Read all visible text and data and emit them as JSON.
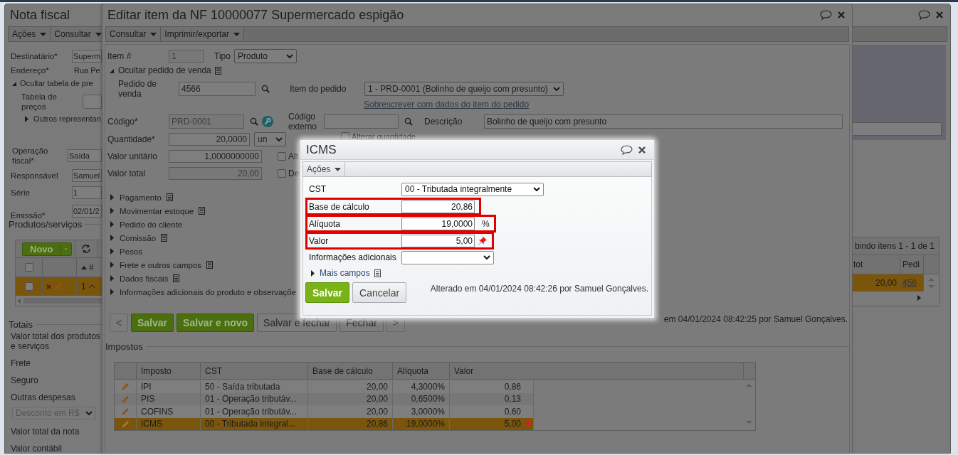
{
  "main_window": {
    "title": "Nota fiscal",
    "menu": [
      {
        "label": "Ações"
      },
      {
        "label": "Consultar"
      }
    ],
    "recipient": {
      "label": "Destinatário*",
      "value": "Superm"
    },
    "address": {
      "label": "Endereço*",
      "value": "Rua Pe"
    },
    "price_toggle": {
      "label": "Ocultar tabela de pre",
      "expanded": true
    },
    "price_table": {
      "label": "Tabela de preços"
    },
    "reps_toggle": {
      "label": "Outros representan",
      "expanded": false
    },
    "fields": [
      {
        "label": "Operação fiscal*",
        "value": "Saída"
      },
      {
        "label": "Responsável",
        "value": "Samuel"
      },
      {
        "label": "Série",
        "value": "1"
      },
      {
        "label": "Emissão*",
        "value": "02/01/2"
      }
    ],
    "products": {
      "title": "Produtos/serviços",
      "new_button": "Novo",
      "all_checked": false,
      "sort_column": "#",
      "pager": "bindo itens 1 - 1 de 1",
      "columns": [
        "tot",
        "Pedi"
      ],
      "rows": [
        {
          "number": "1",
          "checked": false,
          "selected": true,
          "total": "20,00",
          "order": "456"
        }
      ]
    },
    "totals": {
      "title": "Totais",
      "labels": [
        "Valor total dos produtos e serviços",
        "Frete",
        "Seguro",
        "Outras despesas"
      ],
      "discount": {
        "value": "Desconto em R$",
        "disabled": true
      },
      "labels_after": [
        "Valor total da nota",
        "Valor contábil"
      ]
    }
  },
  "editor": {
    "title": "Editar item da NF 10000077 Supermercado espigão",
    "menu": [
      {
        "label": "Consultar"
      },
      {
        "label": "Imprimir/exportar"
      }
    ],
    "item_number": {
      "label": "Item #",
      "value": "1",
      "disabled": true
    },
    "type": {
      "label": "Tipo",
      "value": "Produto"
    },
    "order_toggle": {
      "label": "Ocultar pedido de venda",
      "expanded": true
    },
    "sales_order": {
      "label": "Pedido de venda",
      "value": "4566",
      "disabled": false
    },
    "order_item": {
      "label": "Item do pedido",
      "value": "1 - PRD-0001 (Bolinho de queijo com presunto)"
    },
    "overwrite_link": "Sobrescrever com dados do item do pedido",
    "code": {
      "label": "Código*",
      "value": "PRD-0001",
      "disabled": true
    },
    "external_code": {
      "label": "Código externo"
    },
    "description": {
      "label": "Descrição",
      "value": "Bolinho de queijo com presunto",
      "disabled": false
    },
    "quantity": {
      "label": "Quantidade*",
      "value": "20,0000",
      "unit": "un",
      "disabled": false
    },
    "change_quantity": {
      "label": "Alterar quantidade",
      "checked": false
    },
    "unit_price": {
      "label": "Valor unitário",
      "value": "1,0000000000",
      "disabled": false
    },
    "unit_price_check": {
      "label": "Alt",
      "checked": false
    },
    "total": {
      "label": "Valor total",
      "value": "20,00",
      "disabled": true
    },
    "total_check": {
      "label": "De",
      "checked": false
    },
    "sections": [
      {
        "label": "Pagamento",
        "expanded": false,
        "note": true
      },
      {
        "label": "Movimentar estoque",
        "expanded": false,
        "note": true
      },
      {
        "label": "Pedido do cliente",
        "expanded": false,
        "note": false
      },
      {
        "label": "Comissão",
        "expanded": false,
        "note": true
      },
      {
        "label": "Pesos",
        "expanded": false,
        "note": false
      },
      {
        "label": "Frete e outros campos",
        "expanded": false,
        "note": true
      },
      {
        "label": "Dados fiscais",
        "expanded": false,
        "note": true
      },
      {
        "label": "Informações adicionais do produto e observaçõe",
        "expanded": false
      }
    ],
    "buttons": [
      {
        "label": "<",
        "kind": "nav"
      },
      {
        "label": "Salvar",
        "kind": "primary"
      },
      {
        "label": "Salvar e novo",
        "kind": "primary"
      },
      {
        "label": "Salvar e fechar",
        "kind": "secondary"
      },
      {
        "label": "Fechar",
        "kind": "secondary"
      },
      {
        "label": ">",
        "kind": "nav"
      }
    ],
    "status": "em 04/01/2024 08:42:25 por Samuel Gonçalves.",
    "taxes": {
      "title": "Impostos",
      "columns": [
        "Imposto",
        "CST",
        "Base de cálculo",
        "Alíquota",
        "Valor"
      ],
      "rows": [
        {
          "tax": "IPI",
          "cst": "50 - Saída tributada",
          "base": "20,00",
          "rate": "4,3000%",
          "value": "0,86",
          "selected": false,
          "pinned": false
        },
        {
          "tax": "PIS",
          "cst": "01 - Operação tributáv...",
          "base": "20,00",
          "rate": "0,6500%",
          "value": "0,13",
          "selected": false,
          "pinned": false
        },
        {
          "tax": "COFINS",
          "cst": "01 - Operação tributáv...",
          "base": "20,00",
          "rate": "3,0000%",
          "value": "0,60",
          "selected": false,
          "pinned": false
        },
        {
          "tax": "ICMS",
          "cst": "00 - Tributada integral...",
          "base": "20,86",
          "rate": "19,0000%",
          "value": "5,00",
          "selected": true,
          "pinned": true
        }
      ]
    }
  },
  "icms_dialog": {
    "title": "ICMS",
    "menu": [
      {
        "label": "Ações"
      }
    ],
    "fields": [
      {
        "kind": "select",
        "label": "CST",
        "value": "00 - Tributada integralmente",
        "highlighted": false
      },
      {
        "kind": "input",
        "label": "Base de cálculo",
        "value": "20,86",
        "highlighted": true
      },
      {
        "kind": "input",
        "label": "Alíquota",
        "value": "19,0000",
        "suffix": "%",
        "highlighted": true
      },
      {
        "kind": "input",
        "label": "Valor",
        "value": "5,00",
        "pinned": true,
        "highlighted": true
      },
      {
        "kind": "select",
        "label": "Informações adicionais",
        "highlighted": false
      }
    ],
    "more_fields": {
      "label": "Mais campos",
      "expanded": false
    },
    "buttons": [
      {
        "label": "Salvar",
        "kind": "primary"
      },
      {
        "label": "Cancelar",
        "kind": "secondary"
      }
    ],
    "status": "Alterado em 04/01/2024 08:42:26 por Samuel Gonçalves."
  }
}
